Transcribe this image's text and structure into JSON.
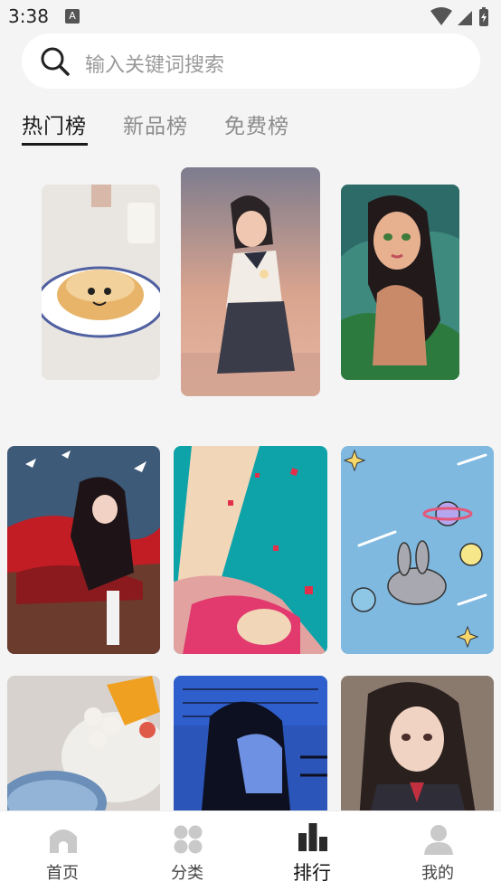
{
  "status_bar": {
    "time": "3:38",
    "notification_badge": "A",
    "icons": [
      "wifi-icon",
      "signal-icon",
      "battery-charging-icon"
    ]
  },
  "search": {
    "placeholder": "输入关键词搜索",
    "icon": "search-icon"
  },
  "tabs": [
    {
      "label": "热门榜",
      "active": true
    },
    {
      "label": "新品榜",
      "active": false
    },
    {
      "label": "免费榜",
      "active": false
    }
  ],
  "podium": [
    {
      "rank": 2,
      "subject": "bread character on plate"
    },
    {
      "rank": 1,
      "subject": "anime girl in sailor uniform at sunset"
    },
    {
      "rank": 3,
      "subject": "illustrated girl in green water"
    }
  ],
  "grid": [
    {
      "subject": "anime girl with red and black ribbons, white doves"
    },
    {
      "subject": "pink haired girl with falling petals on teal"
    },
    {
      "subject": "grey bunny in space with planets"
    },
    {
      "subject": "fruit dessert with mango and taro balls"
    },
    {
      "subject": "blue illustrated couple with text background"
    },
    {
      "subject": "dark haired anime girl in uniform"
    }
  ],
  "bottom_nav": [
    {
      "label": "首页",
      "icon": "home-icon",
      "active": false
    },
    {
      "label": "分类",
      "icon": "category-grid-icon",
      "active": false
    },
    {
      "label": "排行",
      "icon": "ranking-bars-icon",
      "active": true
    },
    {
      "label": "我的",
      "icon": "profile-icon",
      "active": false
    }
  ],
  "colors": {
    "accent": "#1a1a1a",
    "inactive_tab": "#8c8c8c",
    "placeholder": "#9a9a9a",
    "background": "#f4f4f4"
  }
}
